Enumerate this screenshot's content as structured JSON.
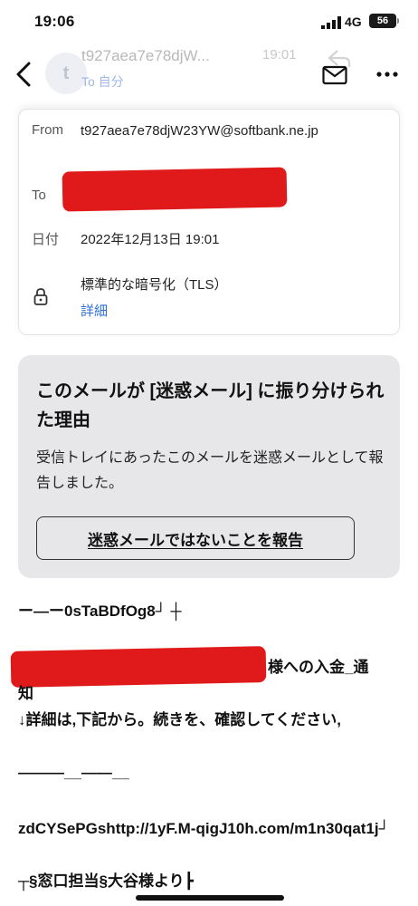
{
  "status_bar": {
    "time": "19:06",
    "network": "4G",
    "battery": "56"
  },
  "header": {
    "avatar_letter": "t",
    "sender": "t927aea7e78djW...",
    "time": "19:01",
    "to": "To 自分"
  },
  "details": {
    "from_label": "From",
    "from_value": "t927aea7e78djW23YW@softbank.ne.jp",
    "to_label": "To",
    "date_label": "日付",
    "date_value": "2022年12月13日 19:01",
    "encryption": "標準的な暗号化（TLS）",
    "details_link": "詳細"
  },
  "spam_notice": {
    "title": "このメールが [迷惑メール] に振り分けられた理由",
    "body": "受信トレイにあったこのメールを迷惑メールとして報告しました。",
    "button": "迷惑メールではないことを報告"
  },
  "message": {
    "line1": "ー—ー0sTaBDfOg8┘ ┼",
    "line2": "様への入金_通",
    "line3": "知",
    "line4": "↓詳細は,下記から。続きを、確認してください,",
    "line5": "———__——__",
    "line6": "zdCYSePGshttp://1yF.M-qigJ10h.com/m1n30qat1j┘",
    "line7": "┬§窓口担当§大谷様より┣"
  },
  "colors": {
    "link": "#2e6fd8",
    "redaction": "#e01a1a",
    "notice_bg": "#e7e7ea"
  }
}
